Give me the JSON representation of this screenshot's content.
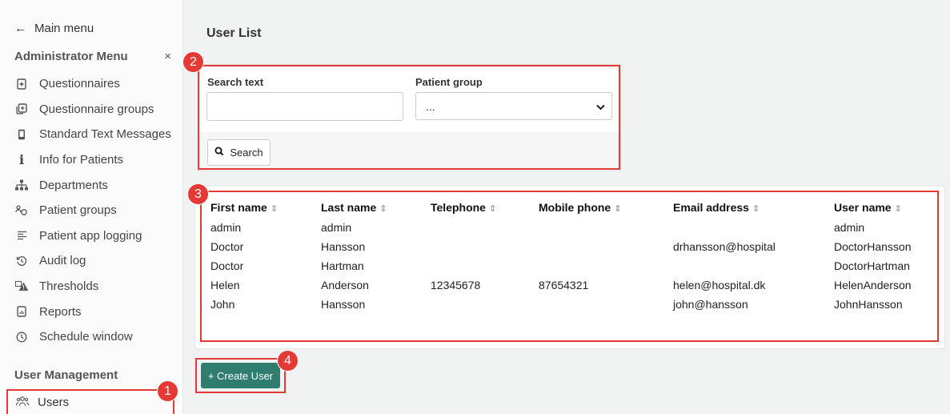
{
  "sidebar": {
    "main_menu": "Main menu",
    "admin_title": "Administrator Menu",
    "close_symbol": "×",
    "items": [
      {
        "label": "Questionnaires",
        "icon": "document-plus-icon"
      },
      {
        "label": "Questionnaire groups",
        "icon": "copy-plus-icon"
      },
      {
        "label": "Standard Text Messages",
        "icon": "phone-icon"
      },
      {
        "label": "Info for Patients",
        "icon": "info-icon"
      },
      {
        "label": "Departments",
        "icon": "sitemap-icon"
      },
      {
        "label": "Patient groups",
        "icon": "users-group-icon"
      },
      {
        "label": "Patient app logging",
        "icon": "lines-icon"
      },
      {
        "label": "Audit log",
        "icon": "history-icon"
      },
      {
        "label": "Thresholds",
        "icon": "threshold-warning-icon"
      },
      {
        "label": "Reports",
        "icon": "report-icon"
      },
      {
        "label": "Schedule window",
        "icon": "clock-icon"
      }
    ],
    "user_management_title": "User Management",
    "users_label": "Users"
  },
  "main": {
    "title": "User List",
    "search": {
      "text_label": "Search text",
      "text_value": "",
      "group_label": "Patient group",
      "group_selected": "...",
      "button_label": "Search"
    },
    "table": {
      "columns": [
        "First name",
        "Last name",
        "Telephone",
        "Mobile phone",
        "Email address",
        "User name"
      ],
      "sort_symbol": "⇕",
      "rows": [
        [
          "admin",
          "admin",
          "",
          "",
          "",
          "admin"
        ],
        [
          "Doctor",
          "Hansson",
          "",
          "",
          "drhansson@hospital",
          "DoctorHansson"
        ],
        [
          "Doctor",
          "Hartman",
          "",
          "",
          "",
          "DoctorHartman"
        ],
        [
          "Helen",
          "Anderson",
          "12345678",
          "87654321",
          "helen@hospital.dk",
          "HelenAnderson"
        ],
        [
          "John",
          "Hansson",
          "",
          "",
          "john@hansson",
          "JohnHansson"
        ]
      ]
    },
    "create_button": "+ Create User"
  },
  "badges": [
    "1",
    "2",
    "3",
    "4"
  ],
  "colors": {
    "highlight": "#e53935",
    "primary_button": "#2e7d6f"
  }
}
